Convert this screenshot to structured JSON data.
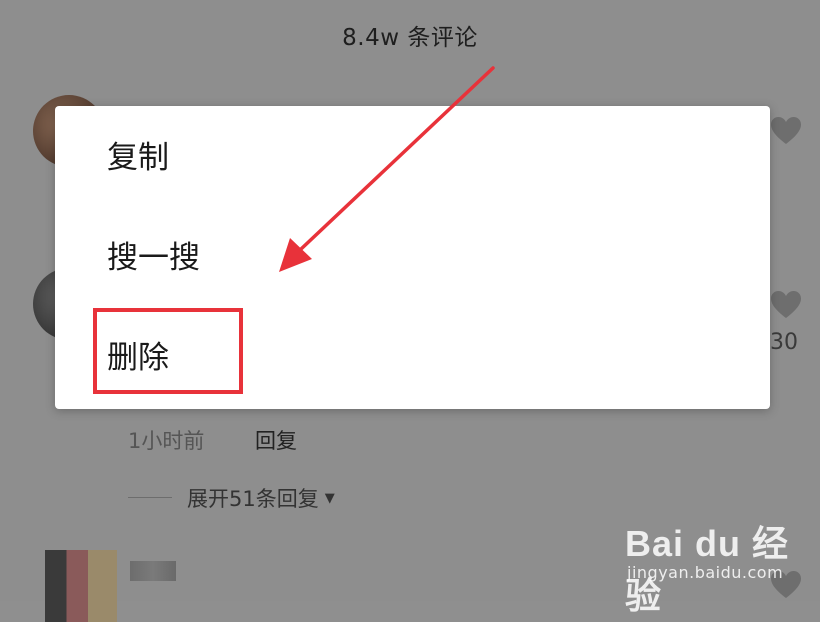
{
  "header": {
    "title": "8.4w 条评论"
  },
  "context_menu": {
    "items": [
      {
        "label": "复制"
      },
      {
        "label": "搜一搜"
      },
      {
        "label": "删除"
      }
    ]
  },
  "comment": {
    "time": "1小时前",
    "reply_label": "回复",
    "expand_label": "展开51条回复",
    "like_count": "30"
  },
  "watermark": {
    "logo_text": "Bai du 经验",
    "url": "jingyan.baidu.com"
  },
  "colors": {
    "overlay": "#8e8e8e",
    "menu_bg": "#ffffff",
    "highlight": "#e8323a"
  },
  "icons": [
    "heart-icon",
    "caret-down-icon",
    "annotation-arrow-icon",
    "paw-icon"
  ]
}
